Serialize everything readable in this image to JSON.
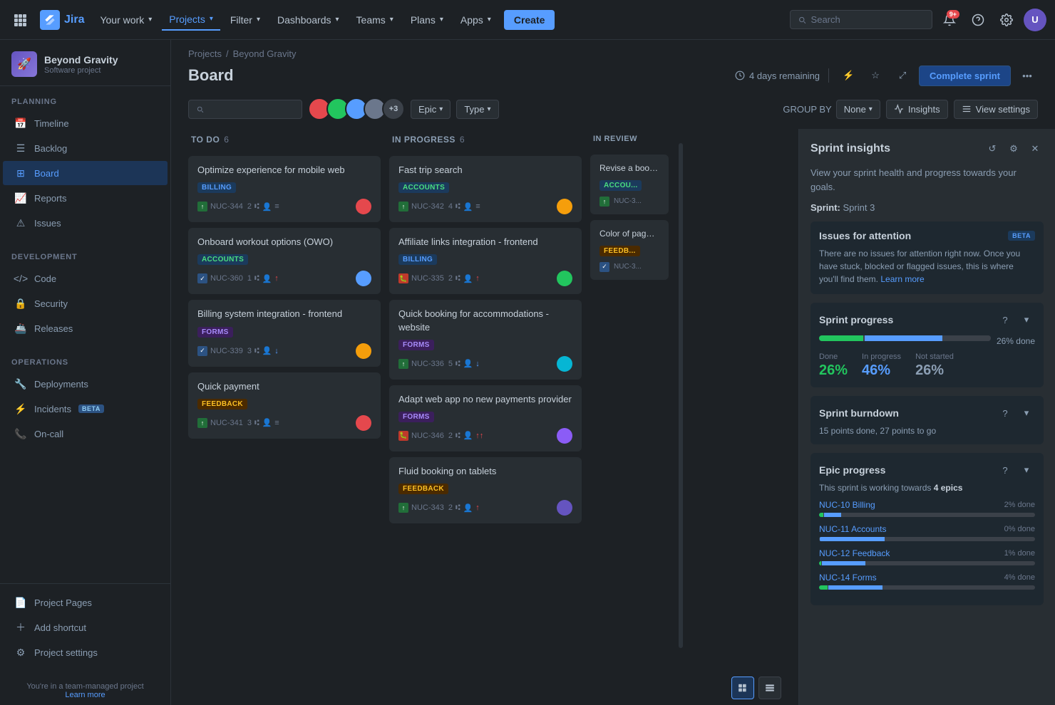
{
  "topnav": {
    "logo_text": "Jira",
    "your_work": "Your work",
    "projects": "Projects",
    "filter": "Filter",
    "dashboards": "Dashboards",
    "teams": "Teams",
    "plans": "Plans",
    "apps": "Apps",
    "create_label": "Create",
    "search_placeholder": "Search",
    "notifications_count": "9+",
    "avatar_initials": "U"
  },
  "sidebar": {
    "project_name": "Beyond Gravity",
    "project_type": "Software project",
    "planning": "PLANNING",
    "timeline": "Timeline",
    "backlog": "Backlog",
    "board": "Board",
    "reports": "Reports",
    "issues": "Issues",
    "development": "DEVELOPMENT",
    "code": "Code",
    "security": "Security",
    "releases": "Releases",
    "operations": "OPERATIONS",
    "deployments": "Deployments",
    "incidents": "Incidents",
    "incidents_beta": "BETA",
    "oncall": "On-call",
    "project_pages": "Project Pages",
    "add_shortcut": "Add shortcut",
    "project_settings": "Project settings",
    "footer_line1": "You're in a team-managed project",
    "footer_link": "Learn more"
  },
  "board": {
    "breadcrumb_projects": "Projects",
    "breadcrumb_project": "Beyond Gravity",
    "title": "Board",
    "sprint_remaining": "4 days remaining",
    "complete_sprint": "Complete sprint",
    "group_by_label": "GROUP BY",
    "group_by_value": "None",
    "insights_label": "Insights",
    "view_settings_label": "View settings",
    "search_placeholder": "",
    "epic_filter": "Epic",
    "type_filter": "Type",
    "avatars_more": "+3"
  },
  "columns": [
    {
      "id": "todo",
      "title": "TO DO",
      "count": 6,
      "cards": [
        {
          "title": "Optimize experience for mobile web",
          "tags": [
            {
              "label": "BILLING",
              "type": "billing"
            }
          ],
          "icon_type": "story",
          "id": "NUC-344",
          "num": 2,
          "priority": "medium",
          "avatar_color": "#e5484d",
          "avatar_initials": ""
        },
        {
          "title": "Onboard workout options (OWO)",
          "tags": [
            {
              "label": "ACCOUNTS",
              "type": "accounts"
            }
          ],
          "icon_type": "task",
          "id": "NUC-360",
          "num": 1,
          "priority": "high",
          "avatar_color": "#579dff",
          "avatar_initials": ""
        },
        {
          "title": "Billing system integration - frontend",
          "tags": [
            {
              "label": "FORMS",
              "type": "forms"
            }
          ],
          "icon_type": "task",
          "id": "NUC-339",
          "num": 3,
          "priority": "low",
          "avatar_color": "#f59e0b",
          "avatar_initials": ""
        },
        {
          "title": "Quick payment",
          "tags": [
            {
              "label": "FEEDBACK",
              "type": "feedback"
            }
          ],
          "icon_type": "story",
          "id": "NUC-341",
          "num": 3,
          "priority": "medium",
          "avatar_color": "#e5484d",
          "avatar_initials": ""
        }
      ]
    },
    {
      "id": "inprogress",
      "title": "IN PROGRESS",
      "count": 6,
      "cards": [
        {
          "title": "Fast trip search",
          "tags": [
            {
              "label": "ACCOUNTS",
              "type": "accounts"
            }
          ],
          "icon_type": "story",
          "id": "NUC-342",
          "num": 4,
          "priority": "medium",
          "avatar_color": "#f59e0b",
          "avatar_initials": ""
        },
        {
          "title": "Affiliate links integration - frontend",
          "tags": [
            {
              "label": "BILLING",
              "type": "billing"
            }
          ],
          "icon_type": "bug",
          "id": "NUC-335",
          "num": 2,
          "priority": "high",
          "avatar_color": "#22c55e",
          "avatar_initials": ""
        },
        {
          "title": "Quick booking for accommodations - website",
          "tags": [
            {
              "label": "FORMS",
              "type": "forms"
            }
          ],
          "icon_type": "story",
          "id": "NUC-336",
          "num": 5,
          "priority": "low",
          "avatar_color": "#06b6d4",
          "avatar_initials": ""
        },
        {
          "title": "Adapt web app no new payments provider",
          "tags": [
            {
              "label": "FORMS",
              "type": "forms"
            }
          ],
          "icon_type": "bug",
          "id": "NUC-346",
          "num": 2,
          "priority": "high",
          "avatar_color": "#8b5cf6",
          "avatar_initials": ""
        },
        {
          "title": "Fluid booking on tablets",
          "tags": [
            {
              "label": "FEEDBACK",
              "type": "feedback"
            }
          ],
          "icon_type": "story",
          "id": "NUC-343",
          "num": 2,
          "priority": "high",
          "avatar_color": "#6554c0",
          "avatar_initials": ""
        }
      ]
    },
    {
      "id": "inreview",
      "title": "IN REVIEW",
      "count": "",
      "cards": [
        {
          "title": "Revise a booking",
          "tags": [
            {
              "label": "ACCOUNTS",
              "type": "accounts"
            }
          ],
          "icon_type": "story",
          "id": "NUC-3",
          "num": 0,
          "priority": "medium",
          "avatar_color": "#e5484d",
          "avatar_initials": ""
        },
        {
          "title": "Color of pages lo",
          "tags": [
            {
              "label": "FEEDBACK",
              "type": "feedback"
            }
          ],
          "icon_type": "task",
          "id": "NUC-3",
          "num": 0,
          "priority": "medium",
          "avatar_color": "#f59e0b",
          "avatar_initials": ""
        }
      ]
    }
  ],
  "insights_panel": {
    "title": "Sprint insights",
    "desc": "View your sprint health and progress towards your goals.",
    "sprint_label": "Sprint:",
    "sprint_value": "Sprint 3",
    "issues_title": "Issues for attention",
    "issues_beta": "BETA",
    "issues_desc": "There are no issues for attention right now. Once you have stuck, blocked or flagged issues, this is where you'll find them.",
    "issues_link": "Learn more",
    "progress_title": "Sprint progress",
    "progress_done_pct": 26,
    "progress_inprogress_pct": 46,
    "progress_notstarted_pct": 28,
    "progress_done_label": "Done",
    "progress_inprogress_label": "In progress",
    "progress_notstarted_label": "Not started",
    "progress_done_val": "26%",
    "progress_inprogress_val": "46%",
    "progress_notstarted_val": "26%",
    "progress_total_label": "26% done",
    "burndown_title": "Sprint burndown",
    "burndown_info": "15 points done, 27 points to go",
    "epic_title": "Epic progress",
    "epic_desc_prefix": "This sprint is working towards",
    "epic_count": "4 epics",
    "epics": [
      {
        "id": "NUC-10",
        "name": "NUC-10 Billing",
        "pct_label": "2% done",
        "done_pct": 2,
        "progress_pct": 8
      },
      {
        "id": "NUC-11",
        "name": "NUC-11 Accounts",
        "pct_label": "0% done",
        "done_pct": 0,
        "progress_pct": 30
      },
      {
        "id": "NUC-12",
        "name": "NUC-12 Feedback",
        "pct_label": "1% done",
        "done_pct": 1,
        "progress_pct": 20
      },
      {
        "id": "NUC-14",
        "name": "NUC-14 Forms",
        "pct_label": "4% done",
        "done_pct": 4,
        "progress_pct": 25
      }
    ]
  },
  "pagination": {
    "page1": "",
    "page2": ""
  }
}
